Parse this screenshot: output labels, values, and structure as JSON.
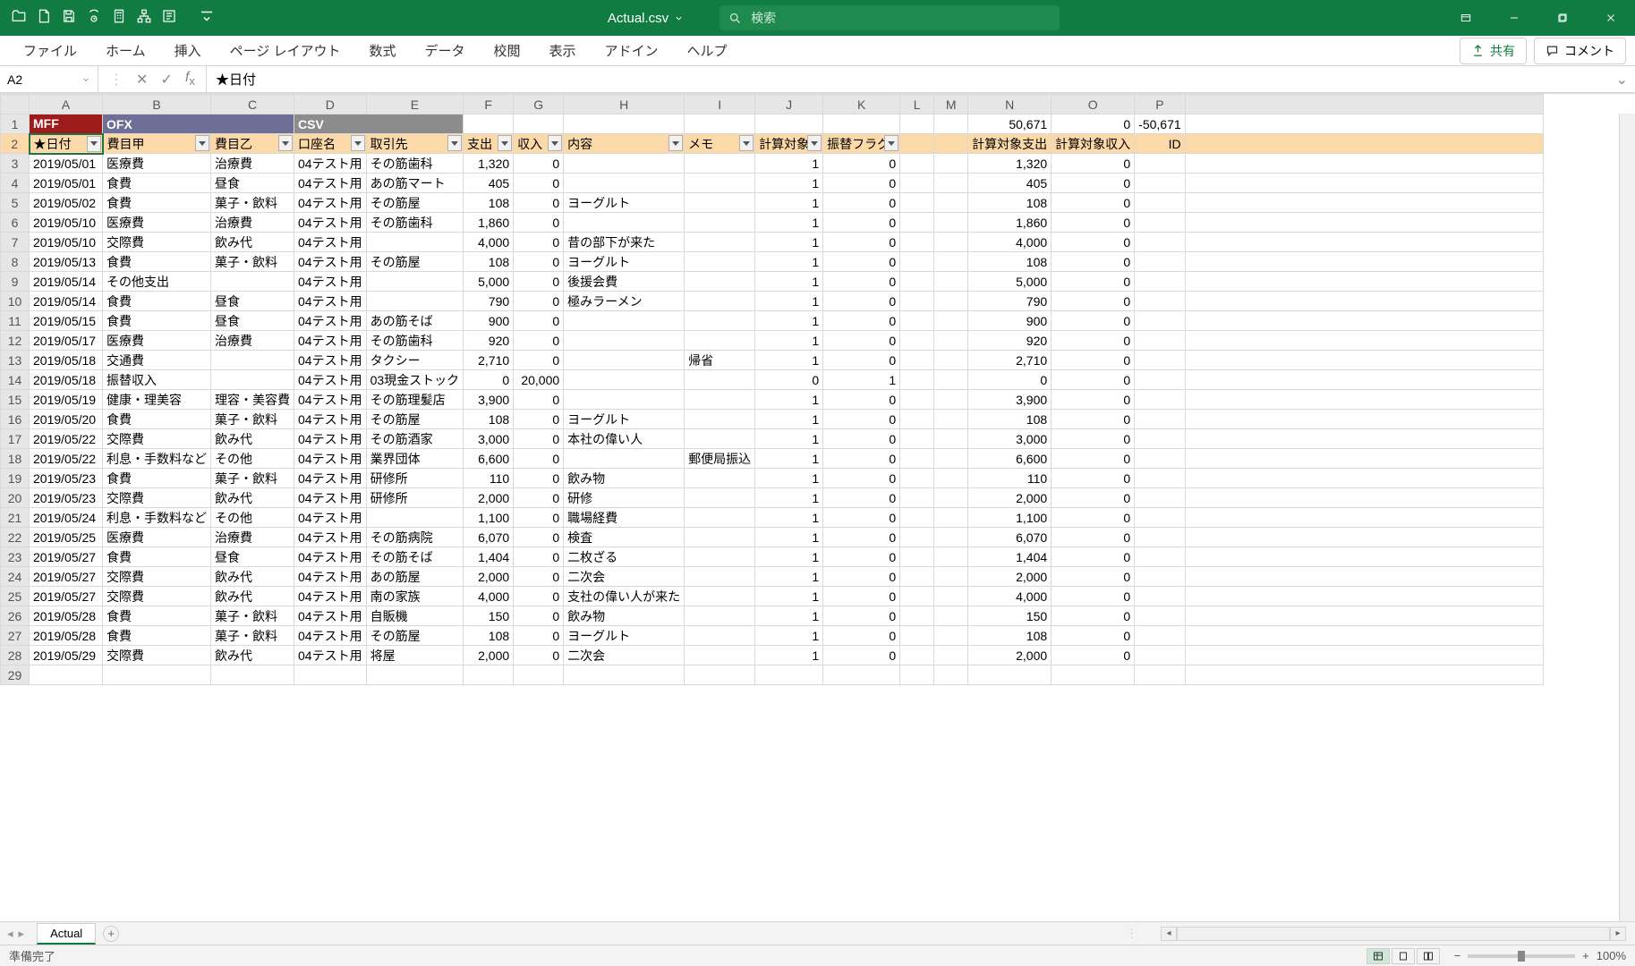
{
  "app": {
    "filename": "Actual.csv",
    "search_placeholder": "検索"
  },
  "ribbon": [
    "ファイル",
    "ホーム",
    "挿入",
    "ページ レイアウト",
    "数式",
    "データ",
    "校閲",
    "表示",
    "アドイン",
    "ヘルプ"
  ],
  "share": {
    "share_label": "共有",
    "comment_label": "コメント"
  },
  "name_box": "A2",
  "formula": "★日付",
  "col_headers": [
    "A",
    "B",
    "C",
    "D",
    "E",
    "F",
    "G",
    "H",
    "I",
    "J",
    "K",
    "L",
    "M",
    "N",
    "O",
    "P"
  ],
  "row1": {
    "a": "MFF",
    "b": "OFX",
    "d": "CSV",
    "n": "50,671",
    "o": "0",
    "p": "-50,671"
  },
  "filters": [
    "★日付",
    "費目甲",
    "費目乙",
    "口座名",
    "取引先",
    "支出",
    "収入",
    "内容",
    "メモ",
    "計算対象",
    "振替フラグ",
    "",
    "",
    "計算対象支出",
    "計算対象収入",
    "ID"
  ],
  "filter_has_dd": [
    true,
    true,
    true,
    true,
    true,
    true,
    true,
    true,
    true,
    true,
    true,
    false,
    false,
    false,
    false,
    false
  ],
  "rows": [
    [
      "2019/05/01",
      "医療費",
      "治療費",
      "04テスト用",
      "その筋歯科",
      "1,320",
      "0",
      "",
      "",
      "1",
      "0",
      "",
      "",
      "1,320",
      "0",
      ""
    ],
    [
      "2019/05/01",
      "食費",
      "昼食",
      "04テスト用",
      "あの筋マート",
      "405",
      "0",
      "",
      "",
      "1",
      "0",
      "",
      "",
      "405",
      "0",
      ""
    ],
    [
      "2019/05/02",
      "食費",
      "菓子・飲料",
      "04テスト用",
      "その筋屋",
      "108",
      "0",
      "ヨーグルト",
      "",
      "1",
      "0",
      "",
      "",
      "108",
      "0",
      ""
    ],
    [
      "2019/05/10",
      "医療費",
      "治療費",
      "04テスト用",
      "その筋歯科",
      "1,860",
      "0",
      "",
      "",
      "1",
      "0",
      "",
      "",
      "1,860",
      "0",
      ""
    ],
    [
      "2019/05/10",
      "交際費",
      "飲み代",
      "04テスト用",
      "",
      "4,000",
      "0",
      "昔の部下が来た",
      "",
      "1",
      "0",
      "",
      "",
      "4,000",
      "0",
      ""
    ],
    [
      "2019/05/13",
      "食費",
      "菓子・飲料",
      "04テスト用",
      "その筋屋",
      "108",
      "0",
      "ヨーグルト",
      "",
      "1",
      "0",
      "",
      "",
      "108",
      "0",
      ""
    ],
    [
      "2019/05/14",
      "その他支出",
      "",
      "04テスト用",
      "",
      "5,000",
      "0",
      "後援会費",
      "",
      "1",
      "0",
      "",
      "",
      "5,000",
      "0",
      ""
    ],
    [
      "2019/05/14",
      "食費",
      "昼食",
      "04テスト用",
      "",
      "790",
      "0",
      "極みラーメン",
      "",
      "1",
      "0",
      "",
      "",
      "790",
      "0",
      ""
    ],
    [
      "2019/05/15",
      "食費",
      "昼食",
      "04テスト用",
      "あの筋そば",
      "900",
      "0",
      "",
      "",
      "1",
      "0",
      "",
      "",
      "900",
      "0",
      ""
    ],
    [
      "2019/05/17",
      "医療費",
      "治療費",
      "04テスト用",
      "その筋歯科",
      "920",
      "0",
      "",
      "",
      "1",
      "0",
      "",
      "",
      "920",
      "0",
      ""
    ],
    [
      "2019/05/18",
      "交通費",
      "",
      "04テスト用",
      "タクシー",
      "2,710",
      "0",
      "",
      "帰省",
      "1",
      "0",
      "",
      "",
      "2,710",
      "0",
      ""
    ],
    [
      "2019/05/18",
      "振替収入",
      "",
      "04テスト用",
      "03現金ストック",
      "0",
      "20,000",
      "",
      "",
      "0",
      "1",
      "",
      "",
      "0",
      "0",
      ""
    ],
    [
      "2019/05/19",
      "健康・理美容",
      "理容・美容費",
      "04テスト用",
      "その筋理髪店",
      "3,900",
      "0",
      "",
      "",
      "1",
      "0",
      "",
      "",
      "3,900",
      "0",
      ""
    ],
    [
      "2019/05/20",
      "食費",
      "菓子・飲料",
      "04テスト用",
      "その筋屋",
      "108",
      "0",
      "ヨーグルト",
      "",
      "1",
      "0",
      "",
      "",
      "108",
      "0",
      ""
    ],
    [
      "2019/05/22",
      "交際費",
      "飲み代",
      "04テスト用",
      "その筋酒家",
      "3,000",
      "0",
      "本社の偉い人",
      "",
      "1",
      "0",
      "",
      "",
      "3,000",
      "0",
      ""
    ],
    [
      "2019/05/22",
      "利息・手数料など",
      "その他",
      "04テスト用",
      "業界団体",
      "6,600",
      "0",
      "",
      "郵便局振込",
      "1",
      "0",
      "",
      "",
      "6,600",
      "0",
      ""
    ],
    [
      "2019/05/23",
      "食費",
      "菓子・飲料",
      "04テスト用",
      "研修所",
      "110",
      "0",
      "飲み物",
      "",
      "1",
      "0",
      "",
      "",
      "110",
      "0",
      ""
    ],
    [
      "2019/05/23",
      "交際費",
      "飲み代",
      "04テスト用",
      "研修所",
      "2,000",
      "0",
      "研修",
      "",
      "1",
      "0",
      "",
      "",
      "2,000",
      "0",
      ""
    ],
    [
      "2019/05/24",
      "利息・手数料など",
      "その他",
      "04テスト用",
      "",
      "1,100",
      "0",
      "職場経費",
      "",
      "1",
      "0",
      "",
      "",
      "1,100",
      "0",
      ""
    ],
    [
      "2019/05/25",
      "医療費",
      "治療費",
      "04テスト用",
      "その筋病院",
      "6,070",
      "0",
      "検査",
      "",
      "1",
      "0",
      "",
      "",
      "6,070",
      "0",
      ""
    ],
    [
      "2019/05/27",
      "食費",
      "昼食",
      "04テスト用",
      "その筋そば",
      "1,404",
      "0",
      "二枚ざる",
      "",
      "1",
      "0",
      "",
      "",
      "1,404",
      "0",
      ""
    ],
    [
      "2019/05/27",
      "交際費",
      "飲み代",
      "04テスト用",
      "あの筋屋",
      "2,000",
      "0",
      "二次会",
      "",
      "1",
      "0",
      "",
      "",
      "2,000",
      "0",
      ""
    ],
    [
      "2019/05/27",
      "交際費",
      "飲み代",
      "04テスト用",
      "南の家族",
      "4,000",
      "0",
      "支社の偉い人が来た",
      "",
      "1",
      "0",
      "",
      "",
      "4,000",
      "0",
      ""
    ],
    [
      "2019/05/28",
      "食費",
      "菓子・飲料",
      "04テスト用",
      "自販機",
      "150",
      "0",
      "飲み物",
      "",
      "1",
      "0",
      "",
      "",
      "150",
      "0",
      ""
    ],
    [
      "2019/05/28",
      "食費",
      "菓子・飲料",
      "04テスト用",
      "その筋屋",
      "108",
      "0",
      "ヨーグルト",
      "",
      "1",
      "0",
      "",
      "",
      "108",
      "0",
      ""
    ],
    [
      "2019/05/29",
      "交際費",
      "飲み代",
      "04テスト用",
      "将屋",
      "2,000",
      "0",
      "二次会",
      "",
      "1",
      "0",
      "",
      "",
      "2,000",
      "0",
      ""
    ]
  ],
  "sheet_tab": "Actual",
  "status": {
    "ready": "準備完了",
    "zoom": "100%"
  }
}
